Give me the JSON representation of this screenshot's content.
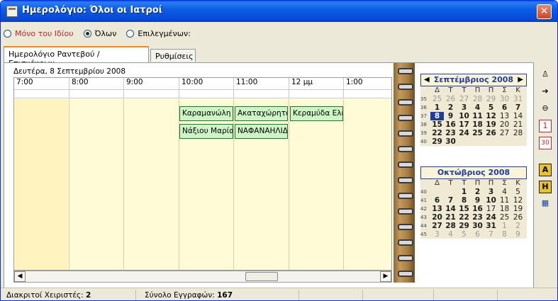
{
  "window": {
    "title": "Ημερολόγιο: Όλοι οι Ιατροί",
    "close_icon": "close-icon"
  },
  "filter": {
    "options": [
      {
        "label": "Μόνο του Ιδίου",
        "selected": false
      },
      {
        "label": "Όλων",
        "selected": true
      },
      {
        "label": "Επιλεγμένων:",
        "selected": false
      }
    ]
  },
  "tabs": [
    {
      "label": "Ημερολόγιο Ραντεβού / Επισκέψεων",
      "active": true
    },
    {
      "label": "Ρυθμίσεις",
      "active": false
    }
  ],
  "schedule": {
    "date": "Δευτέρα, 8 Σεπτεμβρίου 2008",
    "hours": [
      "7:00",
      "8:00",
      "9:00",
      "10:00",
      "11:00",
      "12 μμ",
      "1:00"
    ],
    "appointments": [
      {
        "text": "Καραμανώλη Ε"
      },
      {
        "text": "Ακαταχώρητο"
      },
      {
        "text": "Κεραμύδα Ελέ"
      },
      {
        "text": "Νάξιου Μαρία"
      },
      {
        "text": "ΝΑΦΑΝΑΗΛΙΔ"
      }
    ]
  },
  "calendar": {
    "months": [
      {
        "title": "Σεπτέμβριος 2008",
        "dow": [
          "Δ",
          "Τ",
          "Τ",
          "Π",
          "Π",
          "Σ",
          "Κ"
        ],
        "weeks": [
          {
            "wk": "35",
            "days": [
              [
                "25",
                "g"
              ],
              [
                "26",
                "g"
              ],
              [
                "27",
                "g"
              ],
              [
                "28",
                "g"
              ],
              [
                "29",
                "g"
              ],
              [
                "30",
                "g"
              ],
              [
                "31",
                "g"
              ]
            ]
          },
          {
            "wk": "36",
            "days": [
              [
                "1",
                "b"
              ],
              [
                "2",
                "b"
              ],
              [
                "3",
                "b"
              ],
              [
                "4",
                "b"
              ],
              [
                "5",
                "b"
              ],
              [
                "6",
                "b"
              ],
              [
                "7",
                "b"
              ]
            ]
          },
          {
            "wk": "37",
            "days": [
              [
                "8",
                "sel"
              ],
              [
                "9",
                "b"
              ],
              [
                "10",
                "b"
              ],
              [
                "11",
                "b"
              ],
              [
                "12",
                "b"
              ],
              [
                "13",
                "n"
              ],
              [
                "14",
                "n"
              ]
            ]
          },
          {
            "wk": "38",
            "days": [
              [
                "15",
                "b"
              ],
              [
                "16",
                "b"
              ],
              [
                "17",
                "b"
              ],
              [
                "18",
                "b"
              ],
              [
                "19",
                "b"
              ],
              [
                "20",
                "n"
              ],
              [
                "21",
                "n"
              ]
            ]
          },
          {
            "wk": "39",
            "days": [
              [
                "22",
                "b"
              ],
              [
                "23",
                "b"
              ],
              [
                "24",
                "b"
              ],
              [
                "25",
                "b"
              ],
              [
                "26",
                "b"
              ],
              [
                "27",
                "n"
              ],
              [
                "28",
                "n"
              ]
            ]
          },
          {
            "wk": "40",
            "days": [
              [
                "29",
                "b"
              ],
              [
                "30",
                "b"
              ],
              [
                "",
                ""
              ],
              [
                "",
                ""
              ],
              [
                "",
                ""
              ],
              [
                "",
                ""
              ],
              [
                "",
                ""
              ]
            ]
          }
        ]
      },
      {
        "title": "Οκτώβριος 2008",
        "dow": [
          "Δ",
          "Τ",
          "Τ",
          "Π",
          "Π",
          "Σ",
          "Κ"
        ],
        "weeks": [
          {
            "wk": "40",
            "days": [
              [
                "",
                ""
              ],
              [
                "",
                ""
              ],
              [
                "1",
                "b"
              ],
              [
                "2",
                "b"
              ],
              [
                "3",
                "b"
              ],
              [
                "4",
                "n"
              ],
              [
                "5",
                "n"
              ]
            ]
          },
          {
            "wk": "41",
            "days": [
              [
                "6",
                "b"
              ],
              [
                "7",
                "b"
              ],
              [
                "8",
                "b"
              ],
              [
                "9",
                "b"
              ],
              [
                "10",
                "b"
              ],
              [
                "11",
                "n"
              ],
              [
                "12",
                "n"
              ]
            ]
          },
          {
            "wk": "42",
            "days": [
              [
                "13",
                "b"
              ],
              [
                "14",
                "b"
              ],
              [
                "15",
                "b"
              ],
              [
                "16",
                "b"
              ],
              [
                "17",
                "n"
              ],
              [
                "18",
                "n"
              ],
              [
                "19",
                "n"
              ]
            ]
          },
          {
            "wk": "43",
            "days": [
              [
                "20",
                "b"
              ],
              [
                "21",
                "b"
              ],
              [
                "22",
                "b"
              ],
              [
                "23",
                "b"
              ],
              [
                "24",
                "b"
              ],
              [
                "25",
                "n"
              ],
              [
                "26",
                "n"
              ]
            ]
          },
          {
            "wk": "44",
            "days": [
              [
                "27",
                "b"
              ],
              [
                "28",
                "b"
              ],
              [
                "29",
                "b"
              ],
              [
                "30",
                "b"
              ],
              [
                "31",
                "b"
              ],
              [
                "1",
                "g"
              ],
              [
                "2",
                "g"
              ]
            ]
          },
          {
            "wk": "45",
            "days": [
              [
                "3",
                "g"
              ],
              [
                "4",
                "g"
              ],
              [
                "5",
                "g"
              ],
              [
                "6",
                "g"
              ],
              [
                "7",
                "g"
              ],
              [
                "8",
                "g"
              ],
              [
                "9",
                "g"
              ]
            ]
          }
        ]
      }
    ]
  },
  "toolbar": {
    "day_view": "1",
    "month_view": "30",
    "a_label": "A",
    "h_label": "H"
  },
  "status": {
    "users_label": "Διακριτοί Χειριστές:",
    "users_value": "2",
    "records_label": "Σύνολο Εγγραφών:",
    "records_value": "167"
  }
}
